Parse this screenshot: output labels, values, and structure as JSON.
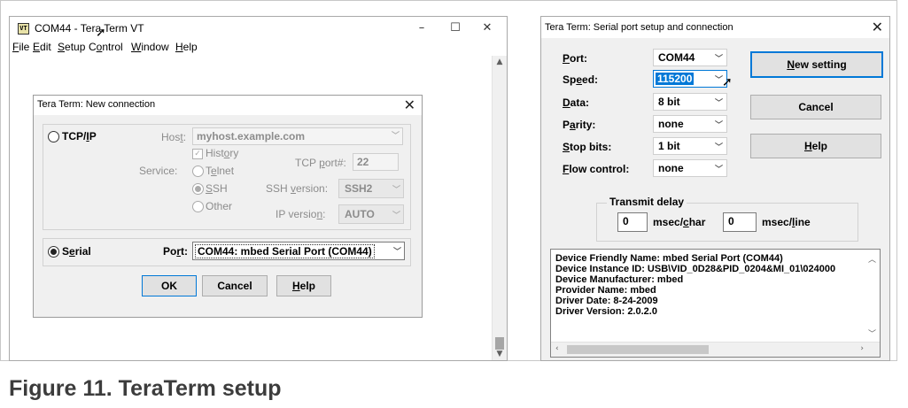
{
  "main_window": {
    "title": "COM44 - Tera Term VT",
    "app_icon": "VT",
    "minimize": "–",
    "maximize": "☐",
    "close": "✕",
    "menu": [
      "File",
      "Edit",
      "Setup",
      "Control",
      "Window",
      "Help"
    ]
  },
  "new_connection": {
    "title": "Tera Term: New connection",
    "close": "✕",
    "tcpip_label": "TCP/IP",
    "host_label": "Host:",
    "host_value": "myhost.example.com",
    "history_label": "History",
    "service_label": "Service:",
    "telnet_label": "Telnet",
    "ssh_label": "SSH",
    "other_label": "Other",
    "tcp_port_label": "TCP port#:",
    "tcp_port_value": "22",
    "ssh_version_label": "SSH version:",
    "ssh_version_value": "SSH2",
    "ip_version_label": "IP version:",
    "ip_version_value": "AUTO",
    "serial_label": "Serial",
    "port_label": "Port:",
    "port_value": "COM44: mbed Serial Port (COM44)",
    "ok_label": "OK",
    "cancel_label": "Cancel",
    "help_label": "Help",
    "selected_type": "Serial"
  },
  "serial_setup": {
    "title": "Tera Term: Serial port setup and connection",
    "close": "✕",
    "fields": [
      {
        "label": "Port:",
        "value": "COM44"
      },
      {
        "label": "Speed:",
        "value": "115200"
      },
      {
        "label": "Data:",
        "value": "8 bit"
      },
      {
        "label": "Parity:",
        "value": "none"
      },
      {
        "label": "Stop bits:",
        "value": "1 bit"
      },
      {
        "label": "Flow control:",
        "value": "none"
      }
    ],
    "new_setting_label": "New setting",
    "cancel_label": "Cancel",
    "help_label": "Help",
    "transmit_delay_label": "Transmit delay",
    "char_delay_value": "0",
    "char_delay_unit": "msec/char",
    "line_delay_value": "0",
    "line_delay_unit": "msec/line",
    "device_info": [
      "Device Friendly Name: mbed Serial Port (COM44)",
      "Device Instance ID: USB\\VID_0D28&PID_0204&MI_01\\024000",
      "Device Manufacturer: mbed",
      "Provider Name: mbed",
      "Driver Date: 8-24-2009",
      "Driver Version: 2.0.2.0"
    ]
  },
  "caption": "Figure 11.   TeraTerm setup",
  "colors": {
    "accent": "#0078d7",
    "dialog_bg": "#f0f0f0",
    "caption": "#3c3c3c"
  }
}
